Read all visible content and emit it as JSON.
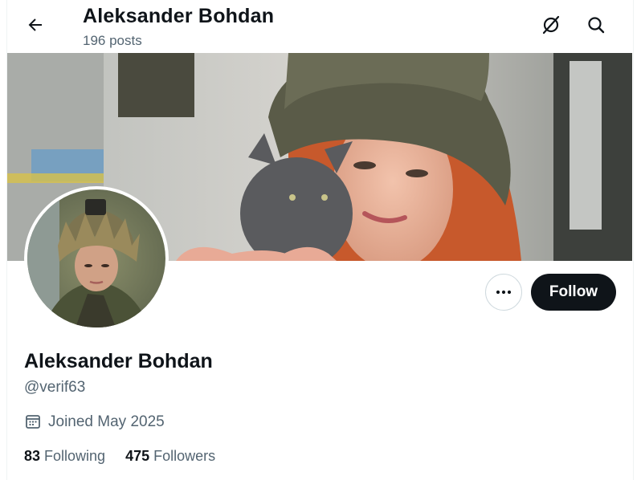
{
  "header": {
    "title": "Aleksander Bohdan",
    "posts_count": "196 posts",
    "back_icon": "arrow-left-icon",
    "grok_icon": "grok-icon",
    "search_icon": "search-icon"
  },
  "profile": {
    "display_name": "Aleksander Bohdan",
    "handle": "@verif63",
    "joined": "Joined May 2025",
    "joined_icon": "calendar-icon"
  },
  "stats": {
    "following_count": "83",
    "following_label": "Following",
    "followers_count": "475",
    "followers_label": "Followers"
  },
  "actions": {
    "follow_label": "Follow",
    "more_icon": "more-dots-icon"
  },
  "colors": {
    "text_primary": "#0f1419",
    "text_secondary": "#536471",
    "follow_bg": "#0f1419",
    "border": "#cfd9de"
  }
}
